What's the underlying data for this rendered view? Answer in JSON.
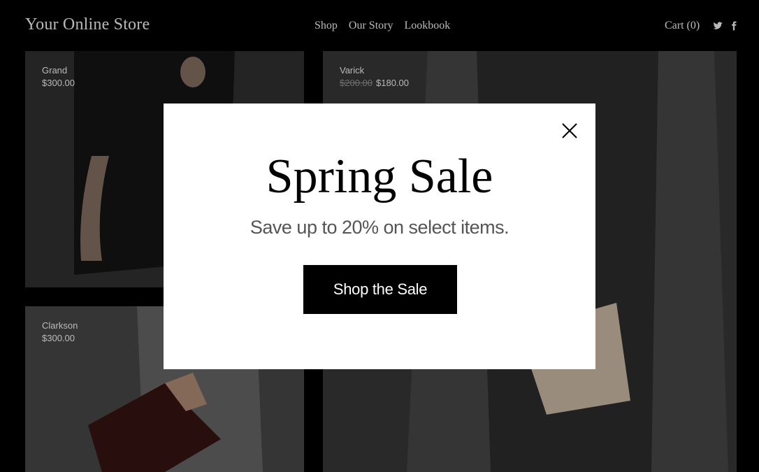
{
  "header": {
    "brand": "Your Online Store",
    "nav": [
      "Shop",
      "Our Story",
      "Lookbook"
    ],
    "cart": "Cart (0)",
    "social": [
      "twitter-icon",
      "facebook-icon"
    ]
  },
  "products": [
    {
      "name": "Grand",
      "price": "$300.00"
    },
    {
      "name": "Varick",
      "old_price": "$200.00",
      "price": "$180.00"
    },
    {
      "name": "Clarkson",
      "price": "$300.00"
    }
  ],
  "modal": {
    "title": "Spring Sale",
    "subtitle": "Save up to 20% on select items.",
    "cta": "Shop the Sale",
    "close_icon": "close-icon"
  },
  "colors": {
    "background": "#000000",
    "modal_bg": "#ffffff",
    "cta_bg": "#000000",
    "subtitle": "#555555"
  }
}
